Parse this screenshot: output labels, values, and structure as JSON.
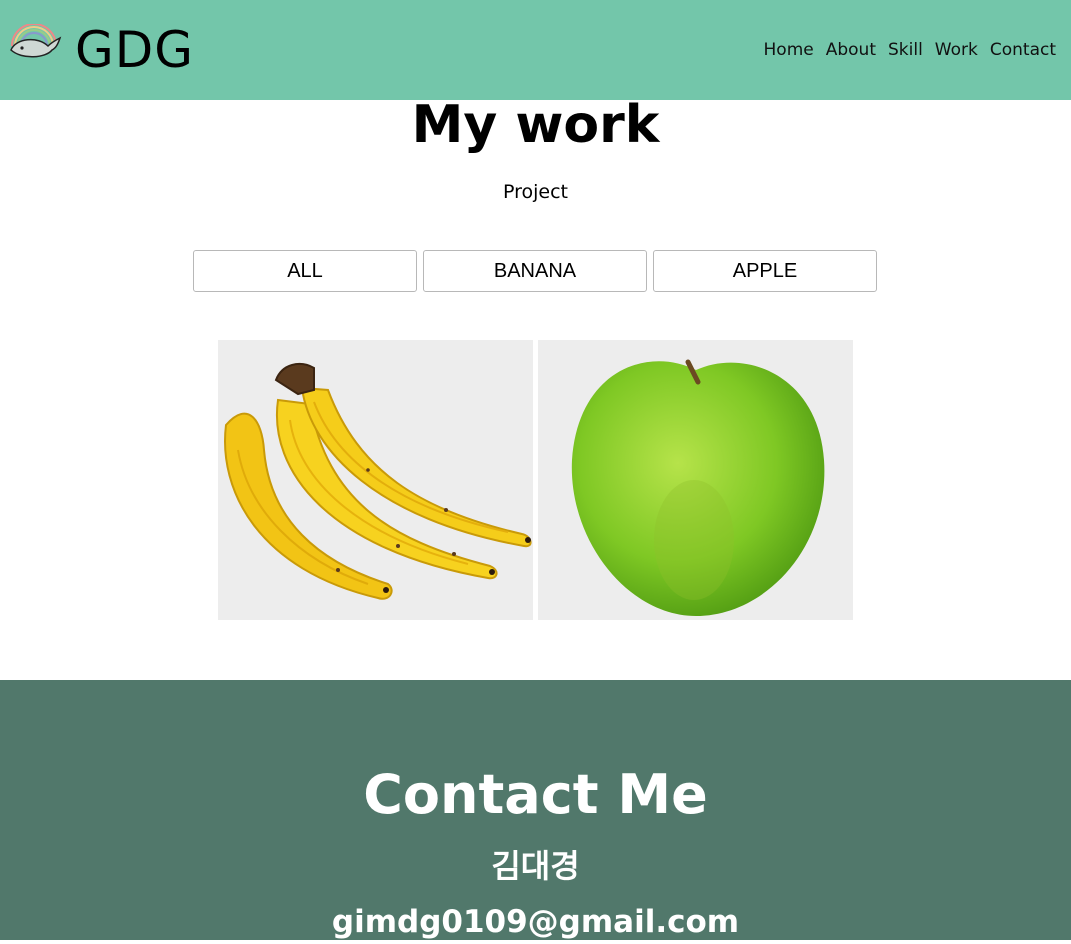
{
  "header": {
    "logo_icon": "whale-rainbow-logo-icon",
    "logo_text": "GDG",
    "nav": [
      "Home",
      "About",
      "Skill",
      "Work",
      "Contact"
    ],
    "bg_color": "#73c6aa"
  },
  "work": {
    "title": "My work",
    "subtitle": "Project",
    "filters": [
      "ALL",
      "BANANA",
      "APPLE"
    ],
    "projects": [
      {
        "image": "banana-image"
      },
      {
        "image": "green-apple-image"
      }
    ]
  },
  "contact": {
    "title": "Contact Me",
    "name": "김대경",
    "email": "gimdg0109@gmail.com",
    "bg_color": "#51786b"
  }
}
